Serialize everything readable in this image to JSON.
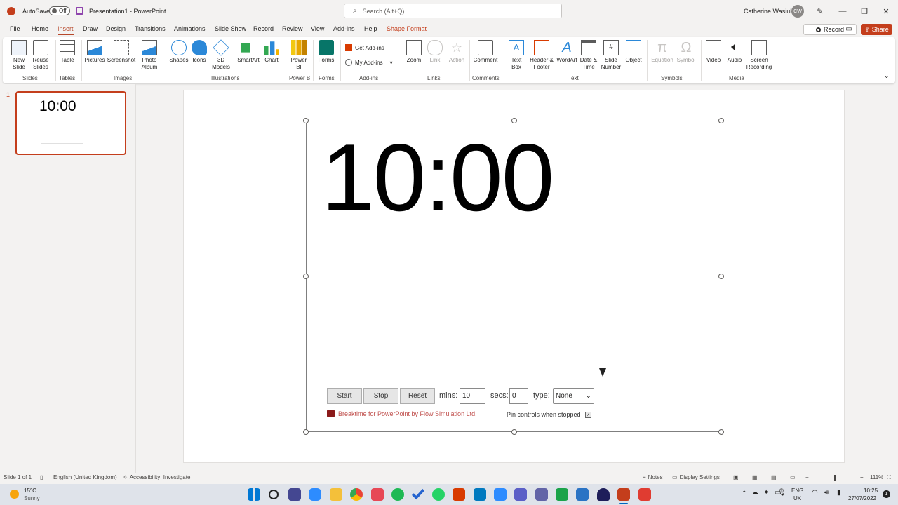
{
  "titlebar": {
    "autosave_label": "AutoSave",
    "autosave_state": "Off",
    "doc_title": "Presentation1  -  PowerPoint",
    "search_placeholder": "Search (Alt+Q)",
    "user_name": "Catherine Wasiuk",
    "user_initials": "CW"
  },
  "menu": {
    "tabs": [
      "File",
      "Home",
      "Insert",
      "Draw",
      "Design",
      "Transitions",
      "Animations",
      "Slide Show",
      "Record",
      "Review",
      "View",
      "Add-ins",
      "Help",
      "Shape Format"
    ],
    "active": "Insert",
    "record_label": "Record",
    "share_label": "Share"
  },
  "ribbon": {
    "items": {
      "new_slide": "New Slide",
      "reuse_slides": "Reuse Slides",
      "table": "Table",
      "pictures": "Pictures",
      "screenshot": "Screenshot",
      "photo_album": "Photo Album",
      "shapes": "Shapes",
      "icons": "Icons",
      "models_3d": "3D Models",
      "smartart": "SmartArt",
      "chart": "Chart",
      "power_bi": "Power BI",
      "forms": "Forms",
      "get_addins": "Get Add-ins",
      "my_addins": "My Add-ins",
      "zoom": "Zoom",
      "link": "Link",
      "action": "Action",
      "comment": "Comment",
      "text_box": "Text Box",
      "header_footer": "Header & Footer",
      "wordart": "WordArt",
      "date_time": "Date & Time",
      "slide_number": "Slide Number",
      "object": "Object",
      "equation": "Equation",
      "symbol": "Symbol",
      "video": "Video",
      "audio": "Audio",
      "screen_recording": "Screen Recording"
    },
    "groups": {
      "slides": "Slides",
      "tables": "Tables",
      "images": "Images",
      "illustrations": "Illustrations",
      "power_bi": "Power BI",
      "forms": "Forms",
      "addins": "Add-ins",
      "links": "Links",
      "comments": "Comments",
      "text": "Text",
      "symbols": "Symbols",
      "media": "Media"
    }
  },
  "thumbnails": {
    "slide_number": "1",
    "slide_text": "10:00"
  },
  "slide": {
    "timer_display": "10:00",
    "start_label": "Start",
    "stop_label": "Stop",
    "reset_label": "Reset",
    "mins_label": "mins:",
    "mins_value": "10",
    "secs_label": "secs:",
    "secs_value": "0",
    "type_label": "type:",
    "type_value": "None",
    "credit_text": "Breaktime for PowerPoint by Flow Simulation Ltd.",
    "pin_label": "Pin controls when stopped",
    "pin_checked": true
  },
  "statusbar": {
    "slide_info": "Slide 1 of 1",
    "language": "English (United Kingdom)",
    "accessibility": "Accessibility: Investigate",
    "notes": "Notes",
    "display_settings": "Display Settings",
    "zoom": "111%"
  },
  "taskbar": {
    "weather_temp": "15°C",
    "weather_desc": "Sunny",
    "lang_line1": "ENG",
    "lang_line2": "UK",
    "time": "10:25",
    "date": "27/07/2022"
  },
  "colors": {
    "accent": "#c43e1c",
    "ribbon_bg": "#ffffff",
    "app_bg": "#f3f2f1"
  }
}
